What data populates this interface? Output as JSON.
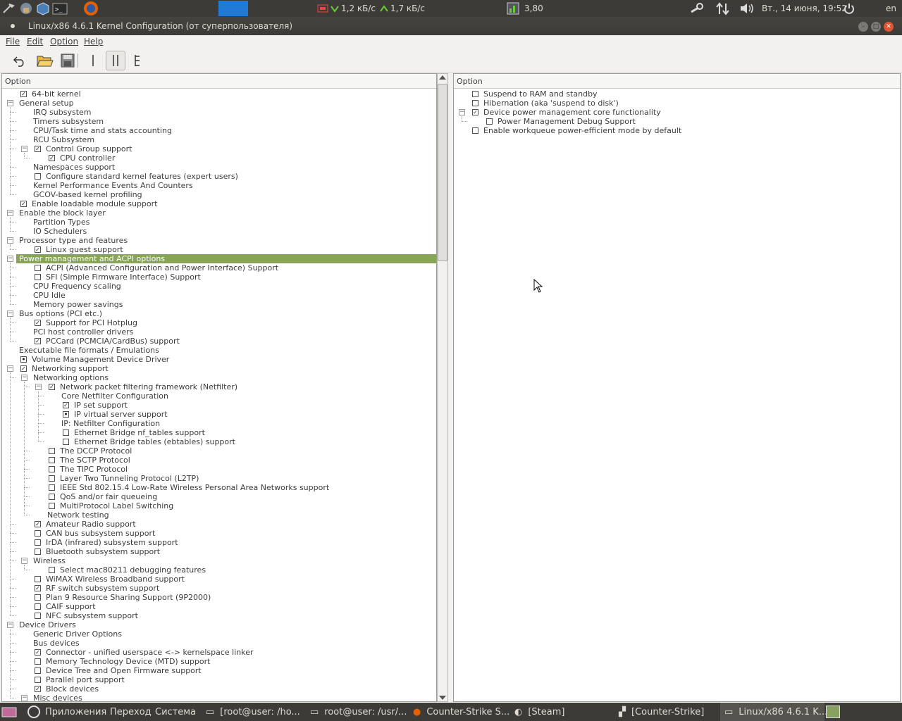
{
  "topbar": {
    "net_down": "1,2 кБ/с",
    "net_up": "1,7 кБ/с",
    "load": "3,80",
    "datetime": "Вт., 14 июня, 19:52",
    "lang": "en"
  },
  "window": {
    "title": "Linux/x86 4.6.1 Kernel Configuration (от суперпользователя)"
  },
  "menu": {
    "file": "File",
    "edit": "Edit",
    "option": "Option",
    "help": "Help"
  },
  "left_pane": {
    "header": "Option",
    "rows": [
      {
        "label": "64-bit kernel",
        "depth": 0,
        "check": "checked",
        "expander": ""
      },
      {
        "label": "General setup",
        "depth": 0,
        "check": "",
        "expander": "open"
      },
      {
        "label": "IRQ subsystem",
        "depth": 1,
        "check": "",
        "expander": ""
      },
      {
        "label": "Timers subsystem",
        "depth": 1,
        "check": "",
        "expander": ""
      },
      {
        "label": "CPU/Task time and stats accounting",
        "depth": 1,
        "check": "",
        "expander": ""
      },
      {
        "label": "RCU Subsystem",
        "depth": 1,
        "check": "",
        "expander": ""
      },
      {
        "label": "Control Group support",
        "depth": 1,
        "check": "checked",
        "expander": "open"
      },
      {
        "label": "CPU controller",
        "depth": 2,
        "check": "checked",
        "expander": ""
      },
      {
        "label": "Namespaces support",
        "depth": 1,
        "check": "",
        "expander": ""
      },
      {
        "label": "Configure standard kernel features (expert users)",
        "depth": 1,
        "check": "unchecked",
        "expander": ""
      },
      {
        "label": "Kernel Performance Events And Counters",
        "depth": 1,
        "check": "",
        "expander": ""
      },
      {
        "label": "GCOV-based kernel profiling",
        "depth": 1,
        "check": "",
        "expander": ""
      },
      {
        "label": "Enable loadable module support",
        "depth": 0,
        "check": "checked",
        "expander": ""
      },
      {
        "label": "Enable the block layer",
        "depth": 0,
        "check": "",
        "expander": "open"
      },
      {
        "label": "Partition Types",
        "depth": 1,
        "check": "",
        "expander": ""
      },
      {
        "label": "IO Schedulers",
        "depth": 1,
        "check": "",
        "expander": ""
      },
      {
        "label": "Processor type and features",
        "depth": 0,
        "check": "",
        "expander": "open"
      },
      {
        "label": "Linux guest support",
        "depth": 1,
        "check": "checked",
        "expander": ""
      },
      {
        "label": "Power management and ACPI options",
        "depth": 0,
        "check": "",
        "expander": "open",
        "selected": true
      },
      {
        "label": "ACPI (Advanced Configuration and Power Interface) Support",
        "depth": 1,
        "check": "unchecked",
        "expander": ""
      },
      {
        "label": "SFI (Simple Firmware Interface) Support",
        "depth": 1,
        "check": "unchecked",
        "expander": ""
      },
      {
        "label": "CPU Frequency scaling",
        "depth": 1,
        "check": "",
        "expander": ""
      },
      {
        "label": "CPU Idle",
        "depth": 1,
        "check": "",
        "expander": ""
      },
      {
        "label": "Memory power savings",
        "depth": 1,
        "check": "",
        "expander": ""
      },
      {
        "label": "Bus options (PCI etc.)",
        "depth": 0,
        "check": "",
        "expander": "open"
      },
      {
        "label": "Support for PCI Hotplug",
        "depth": 1,
        "check": "checked",
        "expander": ""
      },
      {
        "label": "PCI host controller drivers",
        "depth": 1,
        "check": "",
        "expander": ""
      },
      {
        "label": "PCCard (PCMCIA/CardBus) support",
        "depth": 1,
        "check": "checked",
        "expander": ""
      },
      {
        "label": "Executable file formats / Emulations",
        "depth": 0,
        "check": "",
        "expander": ""
      },
      {
        "label": "Volume Management Device Driver",
        "depth": 0,
        "check": "module",
        "expander": ""
      },
      {
        "label": "Networking support",
        "depth": 0,
        "check": "checked",
        "expander": "open"
      },
      {
        "label": "Networking options",
        "depth": 1,
        "check": "",
        "expander": "open"
      },
      {
        "label": "Network packet filtering framework (Netfilter)",
        "depth": 2,
        "check": "checked",
        "expander": "open"
      },
      {
        "label": "Core Netfilter Configuration",
        "depth": 3,
        "check": "",
        "expander": ""
      },
      {
        "label": "IP set support",
        "depth": 3,
        "check": "checked",
        "expander": ""
      },
      {
        "label": "IP virtual server support",
        "depth": 3,
        "check": "module",
        "expander": ""
      },
      {
        "label": "IP: Netfilter Configuration",
        "depth": 3,
        "check": "",
        "expander": ""
      },
      {
        "label": "Ethernet Bridge nf_tables support",
        "depth": 3,
        "check": "unchecked",
        "expander": ""
      },
      {
        "label": "Ethernet Bridge tables (ebtables) support",
        "depth": 3,
        "check": "unchecked",
        "expander": ""
      },
      {
        "label": "The DCCP Protocol",
        "depth": 2,
        "check": "unchecked",
        "expander": ""
      },
      {
        "label": "The SCTP Protocol",
        "depth": 2,
        "check": "unchecked",
        "expander": ""
      },
      {
        "label": "The TIPC Protocol",
        "depth": 2,
        "check": "unchecked",
        "expander": ""
      },
      {
        "label": "Layer Two Tunneling Protocol (L2TP)",
        "depth": 2,
        "check": "unchecked",
        "expander": ""
      },
      {
        "label": "IEEE Std 802.15.4 Low-Rate Wireless Personal Area Networks support",
        "depth": 2,
        "check": "unchecked",
        "expander": ""
      },
      {
        "label": "QoS and/or fair queueing",
        "depth": 2,
        "check": "unchecked",
        "expander": ""
      },
      {
        "label": "MultiProtocol Label Switching",
        "depth": 2,
        "check": "unchecked",
        "expander": ""
      },
      {
        "label": "Network testing",
        "depth": 2,
        "check": "",
        "expander": ""
      },
      {
        "label": "Amateur Radio support",
        "depth": 1,
        "check": "checked",
        "expander": ""
      },
      {
        "label": "CAN bus subsystem support",
        "depth": 1,
        "check": "unchecked",
        "expander": ""
      },
      {
        "label": "IrDA (infrared) subsystem support",
        "depth": 1,
        "check": "unchecked",
        "expander": ""
      },
      {
        "label": "Bluetooth subsystem support",
        "depth": 1,
        "check": "unchecked",
        "expander": ""
      },
      {
        "label": "Wireless",
        "depth": 1,
        "check": "",
        "expander": "open"
      },
      {
        "label": "Select mac80211 debugging features",
        "depth": 2,
        "check": "unchecked",
        "expander": ""
      },
      {
        "label": "WiMAX Wireless Broadband support",
        "depth": 1,
        "check": "unchecked",
        "expander": ""
      },
      {
        "label": "RF switch subsystem support",
        "depth": 1,
        "check": "checked",
        "expander": ""
      },
      {
        "label": "Plan 9 Resource Sharing Support (9P2000)",
        "depth": 1,
        "check": "unchecked",
        "expander": ""
      },
      {
        "label": "CAIF support",
        "depth": 1,
        "check": "unchecked",
        "expander": ""
      },
      {
        "label": "NFC subsystem support",
        "depth": 1,
        "check": "unchecked",
        "expander": ""
      },
      {
        "label": "Device Drivers",
        "depth": 0,
        "check": "",
        "expander": "open"
      },
      {
        "label": "Generic Driver Options",
        "depth": 1,
        "check": "",
        "expander": ""
      },
      {
        "label": "Bus devices",
        "depth": 1,
        "check": "",
        "expander": ""
      },
      {
        "label": "Connector - unified userspace <-> kernelspace linker",
        "depth": 1,
        "check": "checked",
        "expander": ""
      },
      {
        "label": "Memory Technology Device (MTD) support",
        "depth": 1,
        "check": "unchecked",
        "expander": ""
      },
      {
        "label": "Device Tree and Open Firmware support",
        "depth": 1,
        "check": "unchecked",
        "expander": ""
      },
      {
        "label": "Parallel port support",
        "depth": 1,
        "check": "unchecked",
        "expander": ""
      },
      {
        "label": "Block devices",
        "depth": 1,
        "check": "checked",
        "expander": ""
      },
      {
        "label": "Misc devices",
        "depth": 1,
        "check": "",
        "expander": "open"
      }
    ]
  },
  "right_pane": {
    "header": "Option",
    "rows": [
      {
        "label": "Suspend to RAM and standby",
        "depth": 0,
        "check": "unchecked",
        "expander": ""
      },
      {
        "label": "Hibernation (aka 'suspend to disk')",
        "depth": 0,
        "check": "unchecked",
        "expander": ""
      },
      {
        "label": "Device power management core functionality",
        "depth": 0,
        "check": "checked",
        "expander": "open"
      },
      {
        "label": "Power Management Debug Support",
        "depth": 1,
        "check": "unchecked",
        "expander": ""
      },
      {
        "label": "Enable workqueue power-efficient mode by default",
        "depth": 0,
        "check": "unchecked",
        "expander": ""
      }
    ]
  },
  "taskbar": {
    "apps": "Приложения",
    "places": "Переход",
    "system": "Система",
    "tasks": [
      "[root@user: /ho...",
      "root@user: /usr/...",
      "Counter-Strike S...",
      "[Steam]",
      "[Counter-Strike]",
      "Linux/x86 4.6.1 K..."
    ]
  },
  "colors": {
    "selection": "#87a556",
    "panel": "#3c3b37"
  }
}
